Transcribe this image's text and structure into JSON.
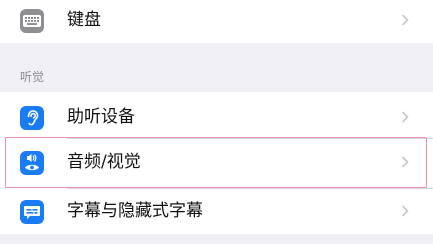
{
  "colors": {
    "page_background": "#efeff4",
    "cell_background": "#ffffff",
    "separator": "#d9d9de",
    "chevron": "#c7c7cc",
    "header_text": "#8a8a8f",
    "highlight_border": "#f08fb6",
    "icon_blue": "#1a7cf5",
    "keyboard_icon_gray": "#8e8e93"
  },
  "top_row": {
    "label": "键盘",
    "icon": "keyboard-icon"
  },
  "hearing_section": {
    "header": "听觉",
    "items": [
      {
        "label": "助听设备",
        "icon": "ear-icon"
      },
      {
        "label": "音频/视觉",
        "icon": "audio-visual-icon",
        "highlighted": true
      },
      {
        "label": "字幕与隐藏式字幕",
        "icon": "subtitles-icon"
      }
    ]
  }
}
